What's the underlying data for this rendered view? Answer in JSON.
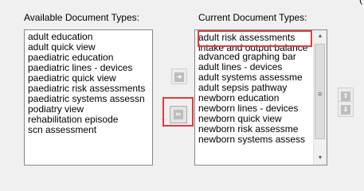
{
  "available": {
    "label": "Available Document Types:",
    "items": [
      "adult education",
      "adult quick view",
      "paediatric education",
      "paediatric lines - devices",
      "paediatric quick view",
      "paediatric risk assessments",
      "paediatric systems assessn",
      "podiatry view",
      "rehabilitation episode",
      "scn assessment"
    ]
  },
  "current": {
    "label": "Current Document Types:",
    "items": [
      "adult risk assessments",
      "intake and output balance",
      "advanced graphing bar",
      "adult lines - devices",
      "adult systems assessme",
      "adult sepsis pathway",
      "newborn education",
      "newborn lines - devices",
      "newborn quick view",
      "newborn risk assessme",
      "newborn systems assess"
    ]
  },
  "buttons": {
    "add_icon": "arrow-right-icon",
    "remove_icon": "arrow-left-icon",
    "move_up_icon": "arrow-up-icon",
    "move_down_icon": "arrow-down-icon"
  },
  "top_edge_text": "("
}
